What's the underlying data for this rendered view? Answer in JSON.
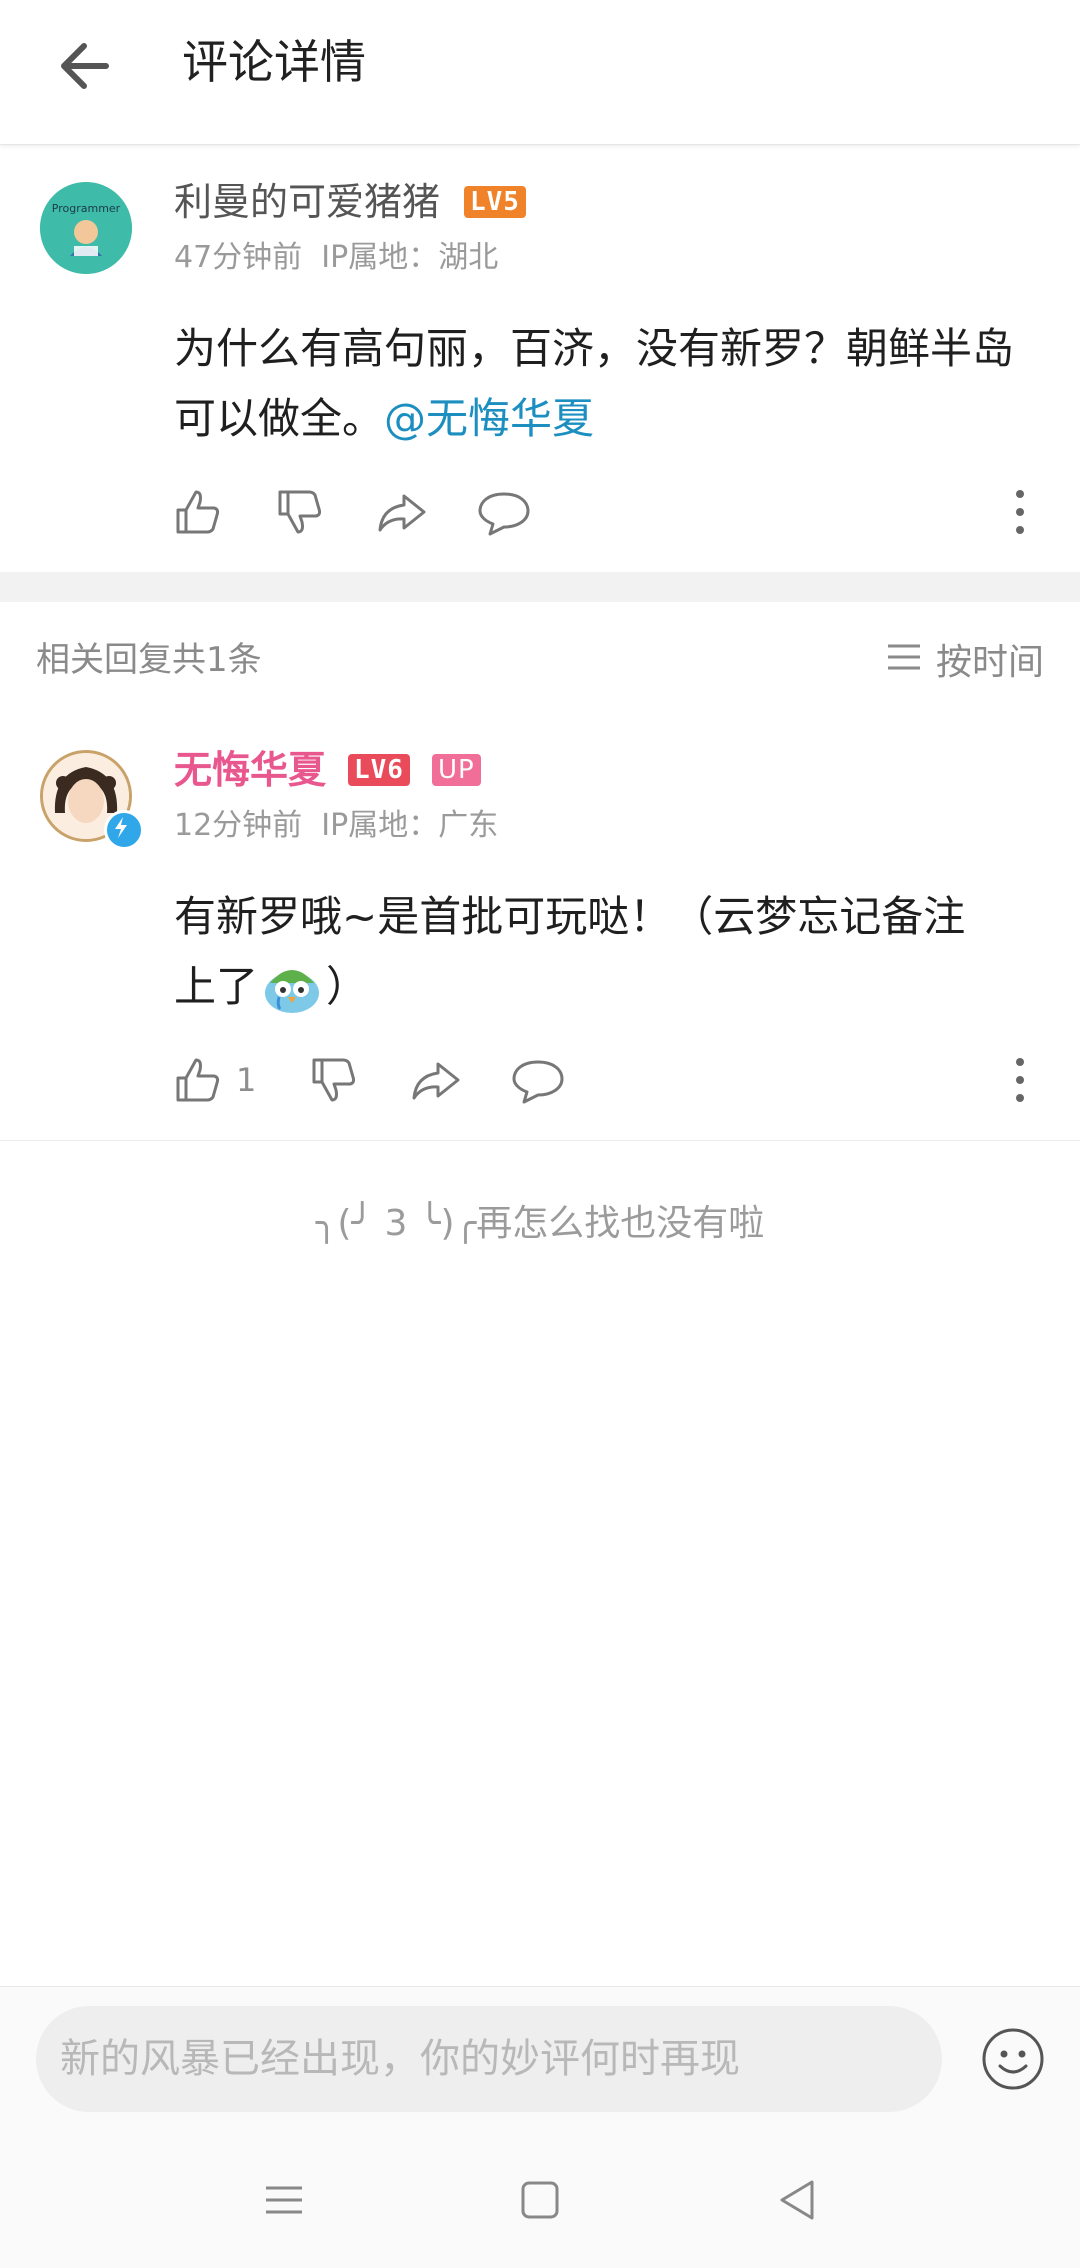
{
  "header": {
    "title": "评论详情"
  },
  "main_comment": {
    "username": "利曼的可爱猪猪",
    "level": "LV5",
    "level_color": "#f0822a",
    "time": "47分钟前",
    "location": "IP属地：湖北",
    "text_before": "为什么有高句丽，百济，没有新罗？朝鲜半岛可以做全。",
    "mention": "@无悔华夏",
    "mention_color": "#1c8fc0"
  },
  "replies": {
    "count_label": "相关回复共1条",
    "sort_label": "按时间"
  },
  "reply": {
    "username": "无悔华夏",
    "username_color": "#e8588f",
    "level": "LV6",
    "level_color": "#e94b5b",
    "up_badge": "UP",
    "up_badge_color": "#f06e97",
    "time": "12分钟前",
    "location": "IP属地：广东",
    "text_line1": "有新罗哦~是首批可玩哒！（云梦忘记备注",
    "text_line2_start": "上了",
    "text_line2_end": "）",
    "emoji_icon": "crying-bird-emoji",
    "like_count": "1"
  },
  "footer": {
    "end_message": "╮(╯ 3 ╰)╭再怎么找也没有啦"
  },
  "input": {
    "placeholder": "新的风暴已经出现，你的妙评何时再现"
  }
}
